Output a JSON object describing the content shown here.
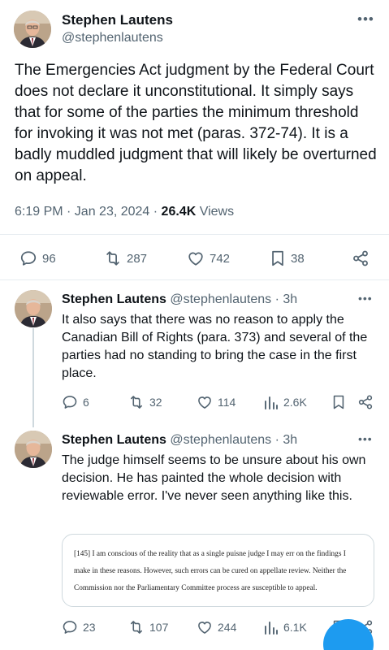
{
  "main_tweet": {
    "author_name": "Stephen Lautens",
    "author_handle": "@stephenlautens",
    "text": "The Emergencies Act judgment by the Federal Court does not declare it unconstitutional. It simply says that for some of the parties the minimum threshold for invoking it was not met (paras. 372-74). It is a badly muddled judgment that will likely be overturned on appeal.",
    "time": "6:19 PM · Jan 23, 2024 · ",
    "views_count": "26.4K",
    "views_label": " Views",
    "replies": "96",
    "reposts": "287",
    "likes": "742",
    "bookmarks": "38"
  },
  "replies": [
    {
      "author_name": "Stephen Lautens",
      "meta": " @stephenlautens · 3h",
      "text": "It also says that there was no reason to apply the Canadian Bill of Rights (para. 373) and several of the parties had no standing to bring the case in the first place.",
      "replies": "6",
      "reposts": "32",
      "likes": "114",
      "views": "2.6K"
    },
    {
      "author_name": "Stephen Lautens",
      "meta": " @stephenlautens · 3h",
      "text": "The judge himself seems to be unsure about his own decision. He has painted the whole decision with reviewable error. I've never seen anything like this.",
      "quote_text": "[145]   I am conscious of the reality that as a single puisne judge I may err on the findings I make in these reasons. However, such errors can be cured on appellate review. Neither the Commission nor the Parliamentary Committee process are susceptible to appeal.",
      "replies": "23",
      "reposts": "107",
      "likes": "244",
      "views": "6.1K"
    }
  ],
  "icons": {
    "more": "more-horizontal-icon",
    "reply": "speech-bubble-icon",
    "repost": "repost-arrows-icon",
    "like": "heart-icon",
    "bookmark": "bookmark-icon",
    "share": "share-icon",
    "views": "bar-chart-icon"
  },
  "colors": {
    "text": "#0f1419",
    "muted": "#536471",
    "accent": "#1d9bf0",
    "border": "#cfd9de"
  }
}
